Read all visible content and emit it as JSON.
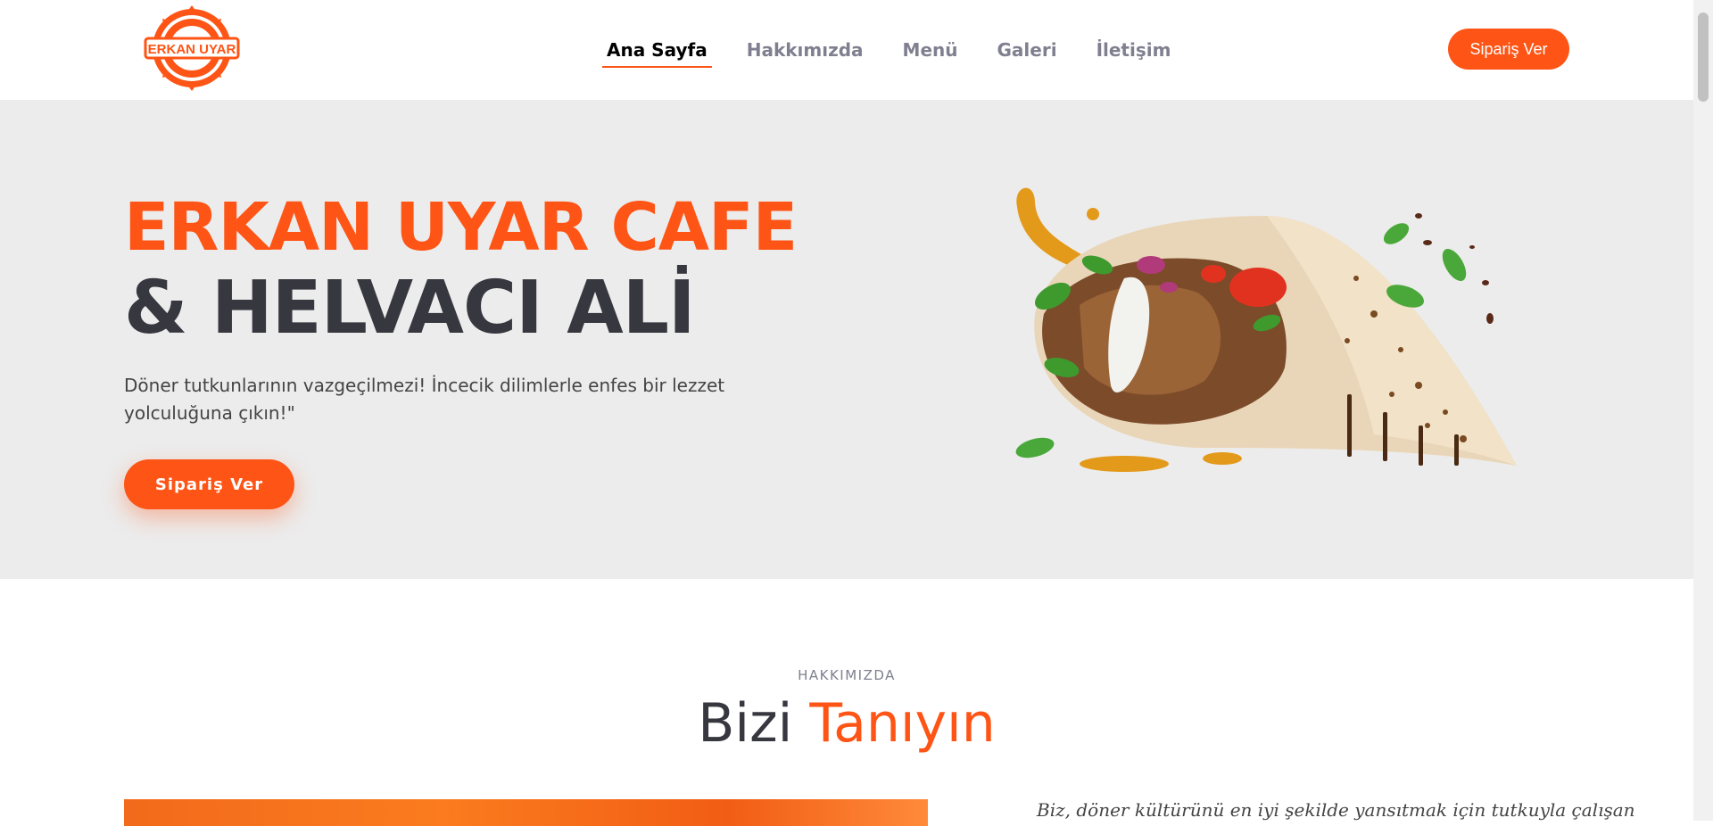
{
  "brand": {
    "logo_text": "ERKAN UYAR",
    "logo_icon": "bottle-cap-badge",
    "accent_color": "#fe5415",
    "dark_color": "#37373f"
  },
  "nav": {
    "items": [
      {
        "label": "Ana Sayfa",
        "active": true
      },
      {
        "label": "Hakkımızda",
        "active": false
      },
      {
        "label": "Menü",
        "active": false
      },
      {
        "label": "Galeri",
        "active": false
      },
      {
        "label": "İletişim",
        "active": false
      }
    ],
    "cta_label": "Sipariş Ver"
  },
  "hero": {
    "title_line1": "ERKAN UYAR CAFE",
    "title_line2": "& HELVACI ALİ",
    "description": "Döner tutkunlarının vazgeçilmezi! İncecik dilimlerle enfes bir lezzet yolculuğuna çıkın!\"",
    "cta_label": "Sipariş Ver",
    "image_icon": "doner-wrap-image"
  },
  "about": {
    "kicker": "HAKKIMIZDA",
    "title_part1": "Bizi",
    "title_part2": "Tanıyın",
    "text_start": "Biz, döner kültürünü en iyi şekilde yansıtmak için tutkuyla çalışan"
  }
}
